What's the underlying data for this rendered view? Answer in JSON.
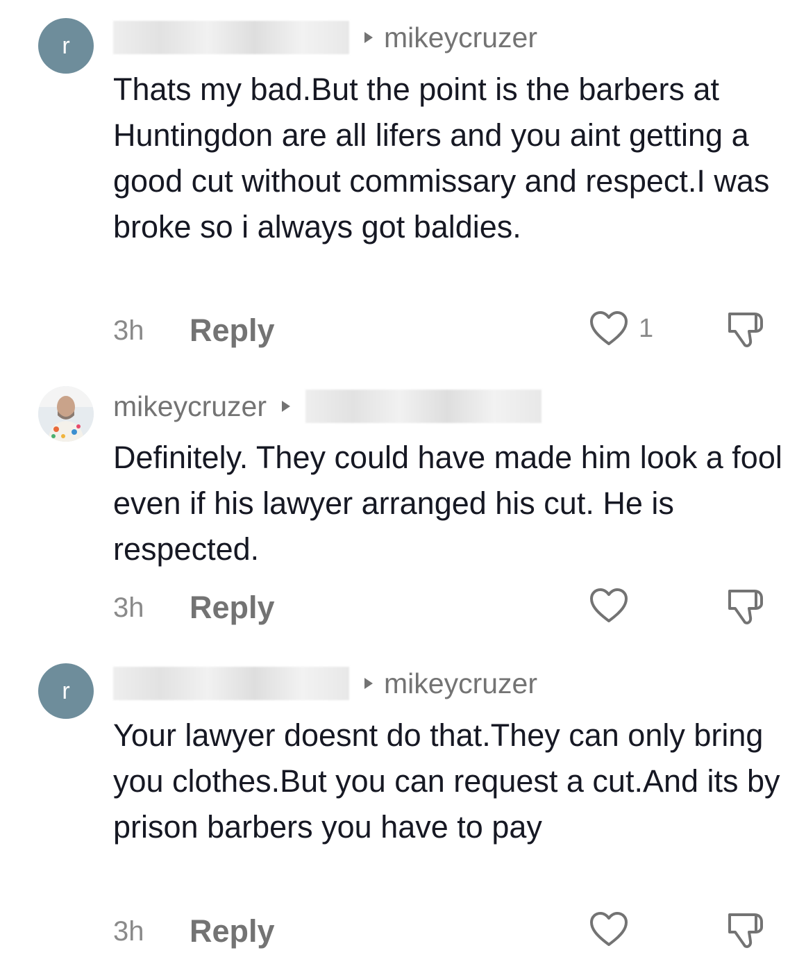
{
  "comments": [
    {
      "avatar_letter": "r",
      "author": "",
      "reply_to": "mikeycruzer",
      "text": "Thats my bad.But the point is the barbers at Huntingdon are all lifers and you aint getting a good cut without commissary and respect.I was broke so i always got baldies.",
      "time": "3h",
      "reply_label": "Reply",
      "like_count": "1"
    },
    {
      "avatar_letter": "",
      "author": "mikeycruzer",
      "reply_to": "",
      "text": "Definitely. They could have made him look a fool even if his lawyer arranged his cut. He is respected.",
      "time": "3h",
      "reply_label": "Reply",
      "like_count": ""
    },
    {
      "avatar_letter": "r",
      "author": "",
      "reply_to": "mikeycruzer",
      "text": "Your lawyer doesnt do that.They can only bring you clothes.But you can request a cut.And its by prison barbers you have to pay",
      "time": "3h",
      "reply_label": "Reply",
      "like_count": ""
    }
  ],
  "colors": {
    "avatar_bg": "#6e8d9b",
    "text": "#161823",
    "muted": "#737373"
  },
  "icons": [
    "heart-icon",
    "dislike-icon",
    "play-arrow-icon"
  ]
}
